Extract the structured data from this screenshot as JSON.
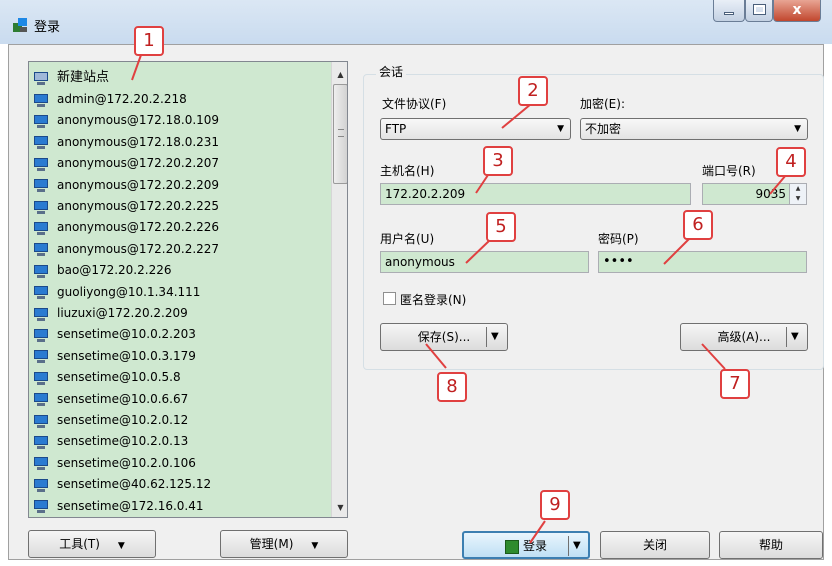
{
  "window": {
    "title": "登录"
  },
  "site_tree": {
    "new_site": "新建站点",
    "sites": [
      "admin@172.20.2.218",
      "anonymous@172.18.0.109",
      "anonymous@172.18.0.231",
      "anonymous@172.20.2.207",
      "anonymous@172.20.2.209",
      "anonymous@172.20.2.225",
      "anonymous@172.20.2.226",
      "anonymous@172.20.2.227",
      "bao@172.20.2.226",
      "guoliyong@10.1.34.111",
      "liuzuxi@172.20.2.209",
      "sensetime@10.0.2.203",
      "sensetime@10.0.3.179",
      "sensetime@10.0.5.8",
      "sensetime@10.0.6.67",
      "sensetime@10.2.0.12",
      "sensetime@10.2.0.13",
      "sensetime@10.2.0.106",
      "sensetime@40.62.125.12",
      "sensetime@172.16.0.41"
    ]
  },
  "buttons": {
    "tools": "工具(T)",
    "manage": "管理(M)",
    "save": "保存(S)...",
    "advanced": "高级(A)...",
    "login": "登录",
    "close": "关闭",
    "help": "帮助"
  },
  "session": {
    "group_label": "会话",
    "protocol_label": "文件协议(F)",
    "protocol_value": "FTP",
    "encryption_label": "加密(E):",
    "encryption_value": "不加密",
    "host_label": "主机名(H)",
    "host_value": "172.20.2.209",
    "port_label": "端口号(R)",
    "port_value": "9035",
    "user_label": "用户名(U)",
    "user_value": "anonymous",
    "password_label": "密码(P)",
    "password_value": "••••",
    "anonymous_label": "匿名登录(N)"
  },
  "callouts": [
    "1",
    "2",
    "3",
    "4",
    "5",
    "6",
    "7",
    "8",
    "9"
  ],
  "colors": {
    "field_bg": "#cfe8d0",
    "callout_border": "#e04040",
    "callout_text": "#c02020"
  }
}
